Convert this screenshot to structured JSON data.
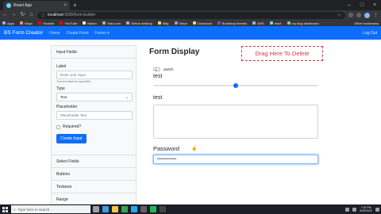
{
  "browser": {
    "tab_title": "React App",
    "tab_close": "×",
    "new_tab": "+",
    "window_controls": [
      "–",
      "□",
      "×"
    ],
    "url_host": "localhost",
    "url_path": ":3000/form-builder",
    "nav_back": "←",
    "nav_forward": "→",
    "nav_reload": "↻",
    "nav_home": "⌂",
    "menu": "⋮",
    "bookmarks": [
      {
        "label": "Apps",
        "color": "#8ab4f8"
      },
      {
        "label": "Mayo",
        "color": "#f28b82"
      },
      {
        "label": "Youtube",
        "color": "#ff0000"
      },
      {
        "label": "YouTube",
        "color": "#ff0000"
      },
      {
        "label": "Notion",
        "color": "#e8eaed"
      },
      {
        "label": "Todo.com",
        "color": "#81c995"
      },
      {
        "label": "Github desktop",
        "color": "#8ab4f8"
      },
      {
        "label": "Bitly",
        "color": "#fdd663"
      },
      {
        "label": "Stripe",
        "color": "#a78bfa"
      },
      {
        "label": "Download",
        "color": "#fdd663"
      },
      {
        "label": "Bootstrap themes",
        "color": "#7952b3"
      },
      {
        "label": "DNS",
        "color": "#8ab4f8"
      },
      {
        "label": "react",
        "color": "#61dafb"
      },
      {
        "label": "my blog dashboard",
        "color": "#81c995"
      }
    ],
    "other_bookmarks": "Other bookmarks"
  },
  "navbar": {
    "brand": "BS Form Creator",
    "links": [
      "Home",
      "Create Form",
      "Forms ▾"
    ],
    "right": "Log Out"
  },
  "sidebar": {
    "header": "Input Fields",
    "label_field": {
      "label": "Label",
      "placeholder": "Enter your input",
      "help": "Your text label for input field"
    },
    "type_field": {
      "label": "Type",
      "value": "Text",
      "caret": "⌄"
    },
    "placeholder_field": {
      "label": "Placeholder",
      "value": "Placeholder Text"
    },
    "required_label": "Required?",
    "create_button": "Create Input",
    "sections": [
      "Select Fields",
      "Buttons",
      "Textarea",
      "Range"
    ]
  },
  "form": {
    "title": "Form Display",
    "delete_zone": "Drag Here To Delete",
    "switch_label": "switch",
    "range_label": "test",
    "range_value": 0.5,
    "textarea_label": "test",
    "password_label": "Password",
    "cursor": "☝",
    "password_value": "••••••••••••"
  },
  "taskbar": {
    "search_placeholder": "Type here to search",
    "search_icon": "⌕",
    "apps": [
      {
        "name": "task-view-icon",
        "color": "#9aa0a6"
      },
      {
        "name": "edge-icon",
        "color": "#3aa0e8"
      },
      {
        "name": "file-explorer-icon",
        "color": "#f4c542"
      },
      {
        "name": "chrome-icon",
        "color": "#34a853"
      },
      {
        "name": "vscode-icon",
        "color": "#23a9f2"
      },
      {
        "name": "terminal-icon",
        "color": "#5f6368"
      },
      {
        "name": "spotify-icon",
        "color": "#1db954"
      },
      {
        "name": "obs-icon",
        "color": "#444444"
      }
    ],
    "time": "7:02 PM",
    "date": "8/29/2021"
  }
}
